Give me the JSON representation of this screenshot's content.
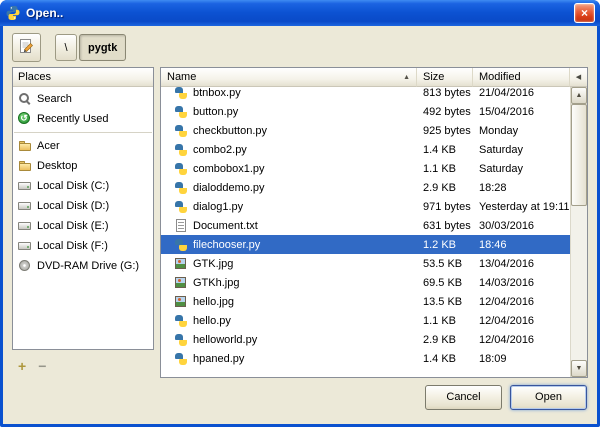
{
  "window": {
    "title": "Open.."
  },
  "icons": {
    "close": "×",
    "sort_asc": "▲",
    "header_left": "◀",
    "scroll_up": "▲",
    "scroll_down": "▼",
    "add": "+",
    "remove": "−"
  },
  "toolbar": {
    "path_root_label": "\\",
    "path_current_label": "pygtk"
  },
  "places": {
    "header": "Places",
    "items": [
      {
        "label": "Search",
        "icon": "search-icon"
      },
      {
        "label": "Recently Used",
        "icon": "recent-icon"
      },
      {
        "separator": true
      },
      {
        "label": "Acer",
        "icon": "folder-icon"
      },
      {
        "label": "Desktop",
        "icon": "folder-icon"
      },
      {
        "label": "Local Disk (C:)",
        "icon": "disk-icon"
      },
      {
        "label": "Local Disk (D:)",
        "icon": "disk-icon"
      },
      {
        "label": "Local Disk (E:)",
        "icon": "disk-icon"
      },
      {
        "label": "Local Disk (F:)",
        "icon": "disk-icon"
      },
      {
        "label": "DVD-RAM Drive (G:)",
        "icon": "dvd-icon"
      }
    ]
  },
  "filelist": {
    "columns": {
      "name": "Name",
      "size": "Size",
      "modified": "Modified"
    },
    "rows": [
      {
        "name": "btnbox.py",
        "size": "813 bytes",
        "modified": "21/04/2016",
        "icon": "py-icon",
        "selected": false
      },
      {
        "name": "button.py",
        "size": "492 bytes",
        "modified": "15/04/2016",
        "icon": "py-icon",
        "selected": false
      },
      {
        "name": "checkbutton.py",
        "size": "925 bytes",
        "modified": "Monday",
        "icon": "py-icon",
        "selected": false
      },
      {
        "name": "combo2.py",
        "size": "1.4 KB",
        "modified": "Saturday",
        "icon": "py-icon",
        "selected": false
      },
      {
        "name": "combobox1.py",
        "size": "1.1 KB",
        "modified": "Saturday",
        "icon": "py-icon",
        "selected": false
      },
      {
        "name": "dialoddemo.py",
        "size": "2.9 KB",
        "modified": "18:28",
        "icon": "py-icon",
        "selected": false
      },
      {
        "name": "dialog1.py",
        "size": "971 bytes",
        "modified": "Yesterday at 19:11",
        "icon": "py-icon",
        "selected": false
      },
      {
        "name": "Document.txt",
        "size": "631 bytes",
        "modified": "30/03/2016",
        "icon": "txt-icon",
        "selected": false
      },
      {
        "name": "filechooser.py",
        "size": "1.2 KB",
        "modified": "18:46",
        "icon": "py-icon",
        "selected": true
      },
      {
        "name": "GTK.jpg",
        "size": "53.5 KB",
        "modified": "13/04/2016",
        "icon": "jpg-icon",
        "selected": false
      },
      {
        "name": "GTKh.jpg",
        "size": "69.5 KB",
        "modified": "14/03/2016",
        "icon": "jpg-icon",
        "selected": false
      },
      {
        "name": "hello.jpg",
        "size": "13.5 KB",
        "modified": "12/04/2016",
        "icon": "jpg-icon",
        "selected": false
      },
      {
        "name": "hello.py",
        "size": "1.1 KB",
        "modified": "12/04/2016",
        "icon": "py-icon",
        "selected": false
      },
      {
        "name": "helloworld.py",
        "size": "2.9 KB",
        "modified": "12/04/2016",
        "icon": "py-icon",
        "selected": false
      },
      {
        "name": "hpaned.py",
        "size": "1.4 KB",
        "modified": "18:09",
        "icon": "py-icon",
        "selected": false
      }
    ]
  },
  "footer": {
    "cancel": "Cancel",
    "open": "Open"
  }
}
